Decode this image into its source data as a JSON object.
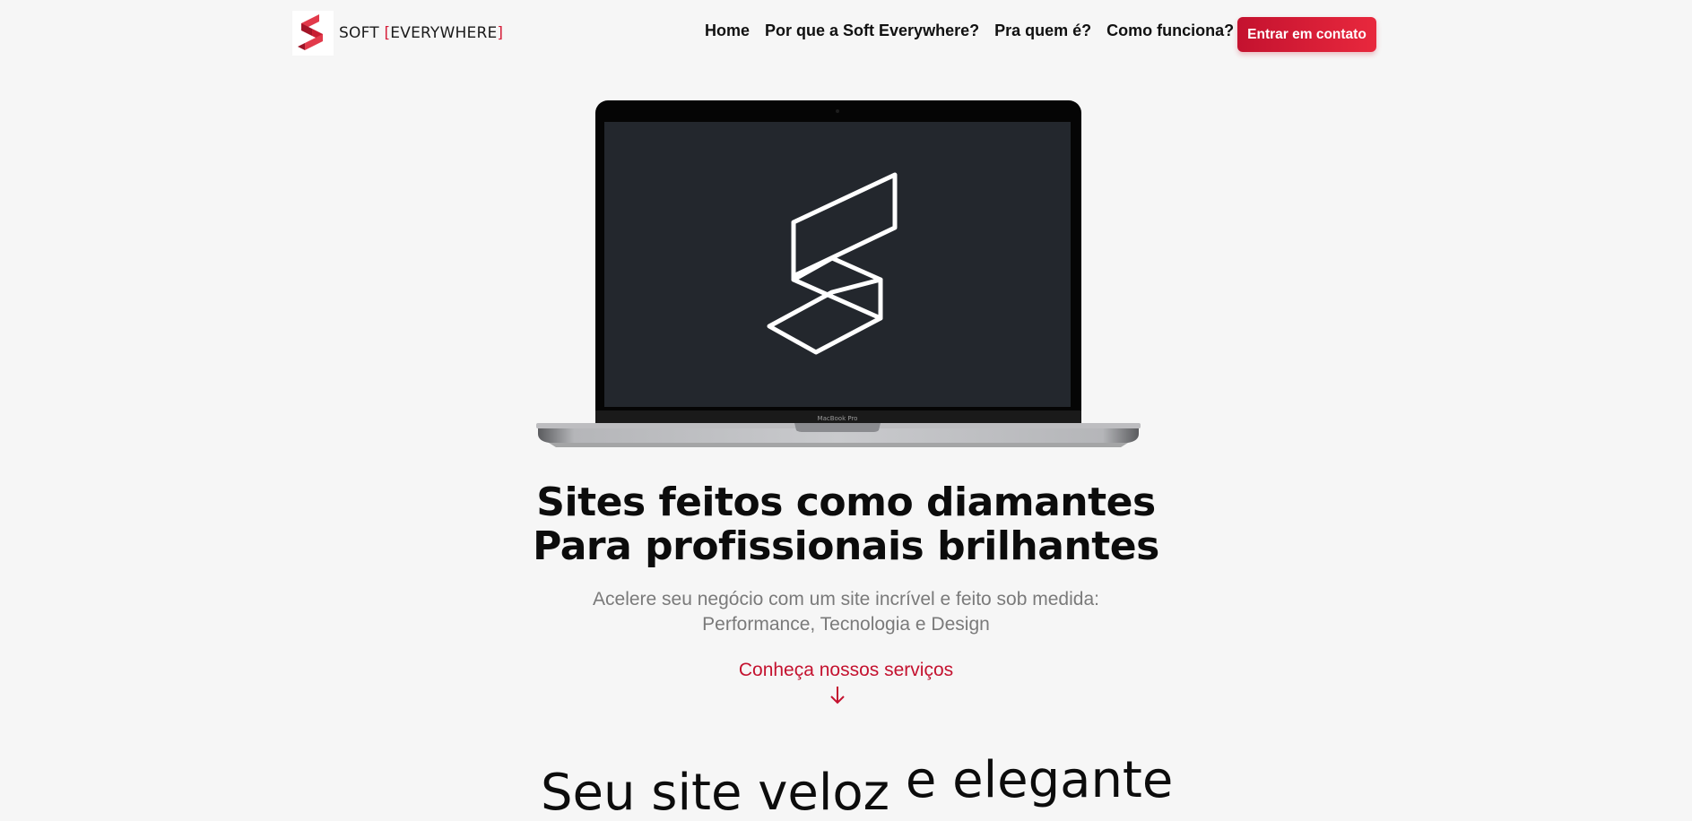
{
  "header": {
    "logo_text_main": "SOFT ",
    "logo_bracket_open": "[",
    "logo_text_word": "EVERYWHERE",
    "logo_bracket_close": "]",
    "nav": [
      {
        "label": "Home"
      },
      {
        "label": "Por que a Soft Everywhere?"
      },
      {
        "label": "Pra quem é?"
      },
      {
        "label": "Como funciona?"
      }
    ],
    "cta_label": "Entrar em contato"
  },
  "laptop": {
    "model_label": "MacBook Pro"
  },
  "hero": {
    "title_line1": "Sites feitos como diamantes",
    "title_line2": "Para profissionais brilhantes",
    "subtitle_line1": "Acelere seu negócio com um site incrível e feito sob medida:",
    "subtitle_line2": "Performance, Tecnologia e Design",
    "services_link": "Conheça nossos serviços"
  },
  "section2": {
    "title_part1": "Seu site veloz",
    "title_part2": "e elegante"
  },
  "colors": {
    "accent": "#c4122f",
    "background": "#f6f6f6",
    "screen": "#23272d"
  }
}
